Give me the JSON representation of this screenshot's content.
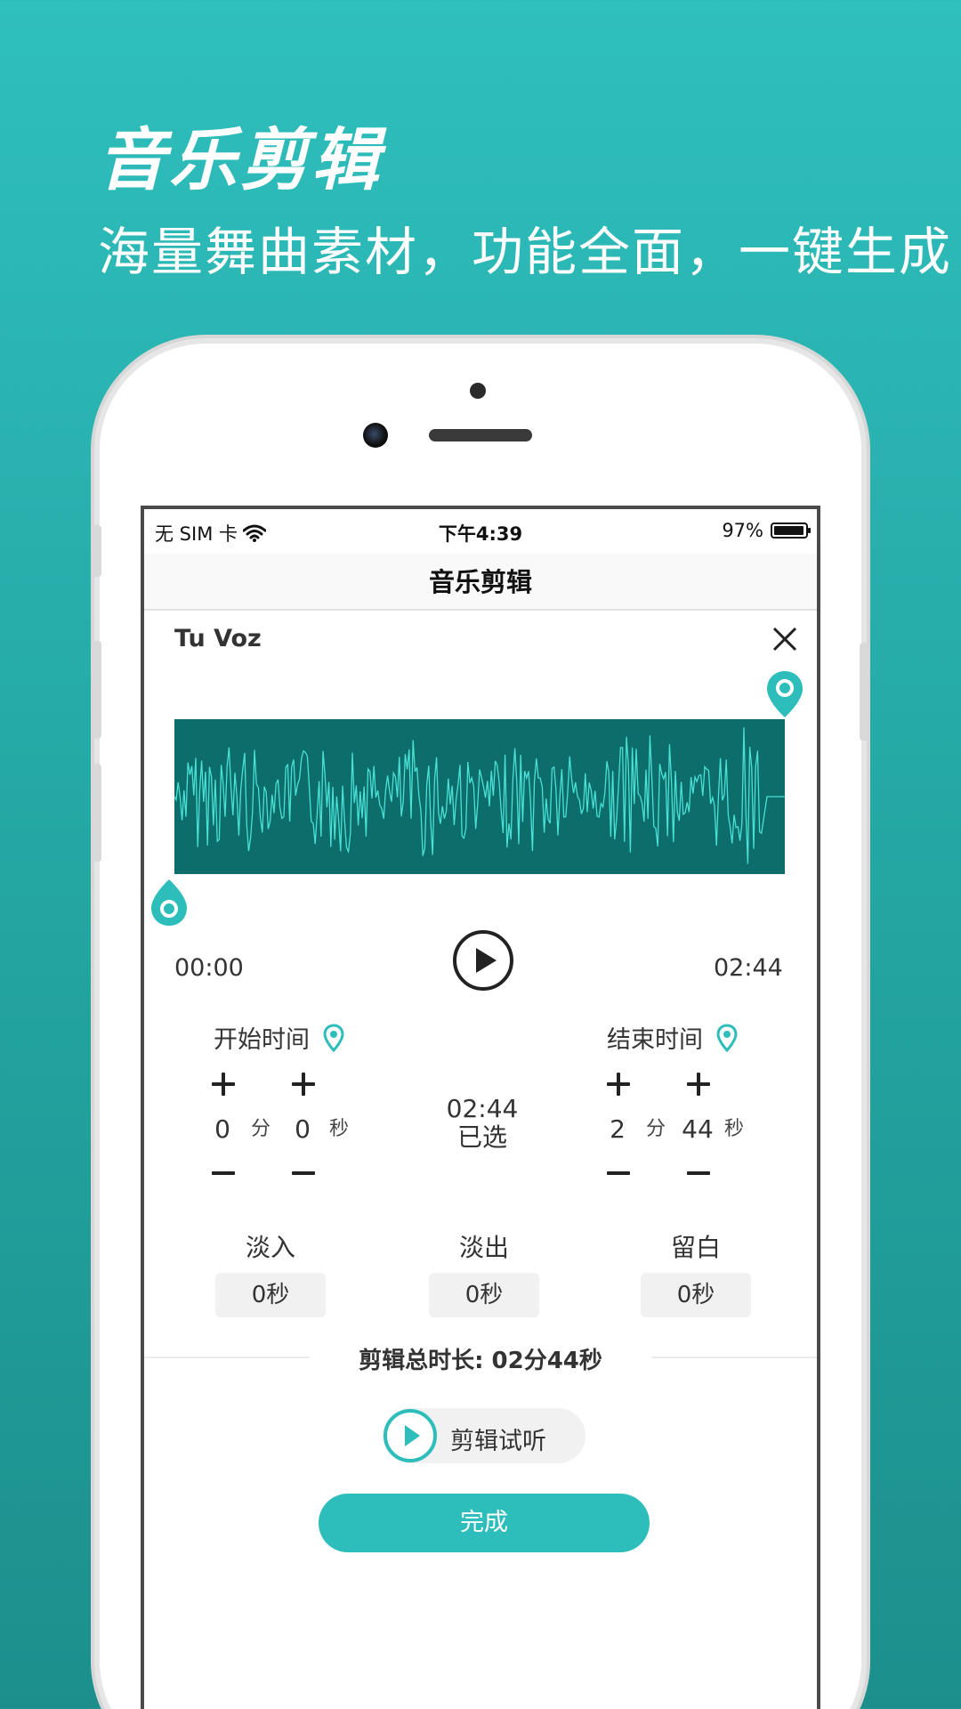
{
  "promo": {
    "title": "音乐剪辑",
    "subtitle": "海量舞曲素材，功能全面，一键生成"
  },
  "status_bar": {
    "carrier": "无 SIM 卡",
    "time": "下午4:39",
    "battery_percent": "97%",
    "battery_level": 0.97
  },
  "nav": {
    "title": "音乐剪辑"
  },
  "song": {
    "title": "Tu Voz"
  },
  "timeline": {
    "start_time": "00:00",
    "end_time": "02:44"
  },
  "start": {
    "label": "开始时间",
    "minutes": "0",
    "seconds": "0",
    "minute_unit": "分",
    "second_unit": "秒"
  },
  "end": {
    "label": "结束时间",
    "minutes": "2",
    "seconds": "44",
    "minute_unit": "分",
    "second_unit": "秒"
  },
  "selection": {
    "duration": "02:44",
    "label": "已选"
  },
  "effects": {
    "fade_in": {
      "label": "淡入",
      "value": "0秒"
    },
    "fade_out": {
      "label": "淡出",
      "value": "0秒"
    },
    "padding": {
      "label": "留白",
      "value": "0秒"
    }
  },
  "total": {
    "text": "剪辑总时长: 02分44秒"
  },
  "preview": {
    "label": "剪辑试听"
  },
  "done": {
    "label": "完成"
  },
  "colors": {
    "accent": "#2dbdba",
    "wave_bg": "#0d6d6a",
    "wave_line": "#49e0d6"
  },
  "icons": {
    "wifi": "wifi-icon",
    "close": "close-icon",
    "play": "play-icon",
    "marker": "location-pin-icon"
  }
}
